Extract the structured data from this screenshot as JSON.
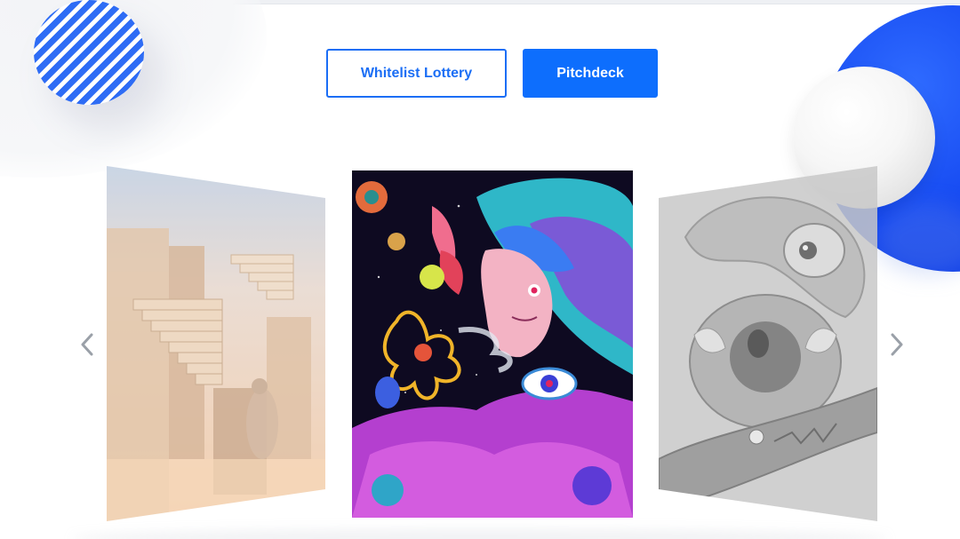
{
  "buttons": {
    "whitelist_label": "Whitelist Lottery",
    "pitchdeck_label": "Pitchdeck"
  },
  "carousel": {
    "slides": [
      {
        "name": "staircase-artwork",
        "position": "previous"
      },
      {
        "name": "psychedelic-portrait-artwork",
        "position": "active"
      },
      {
        "name": "grayscale-creature-artwork",
        "position": "next"
      }
    ],
    "prev_icon": "chevron-left-icon",
    "next_icon": "chevron-right-icon"
  },
  "colors": {
    "accent": "#0d6efd",
    "accent_outline": "#1b6ef5",
    "decor_blue": "#1346f0",
    "stripe_blue": "#2e6cf5"
  }
}
